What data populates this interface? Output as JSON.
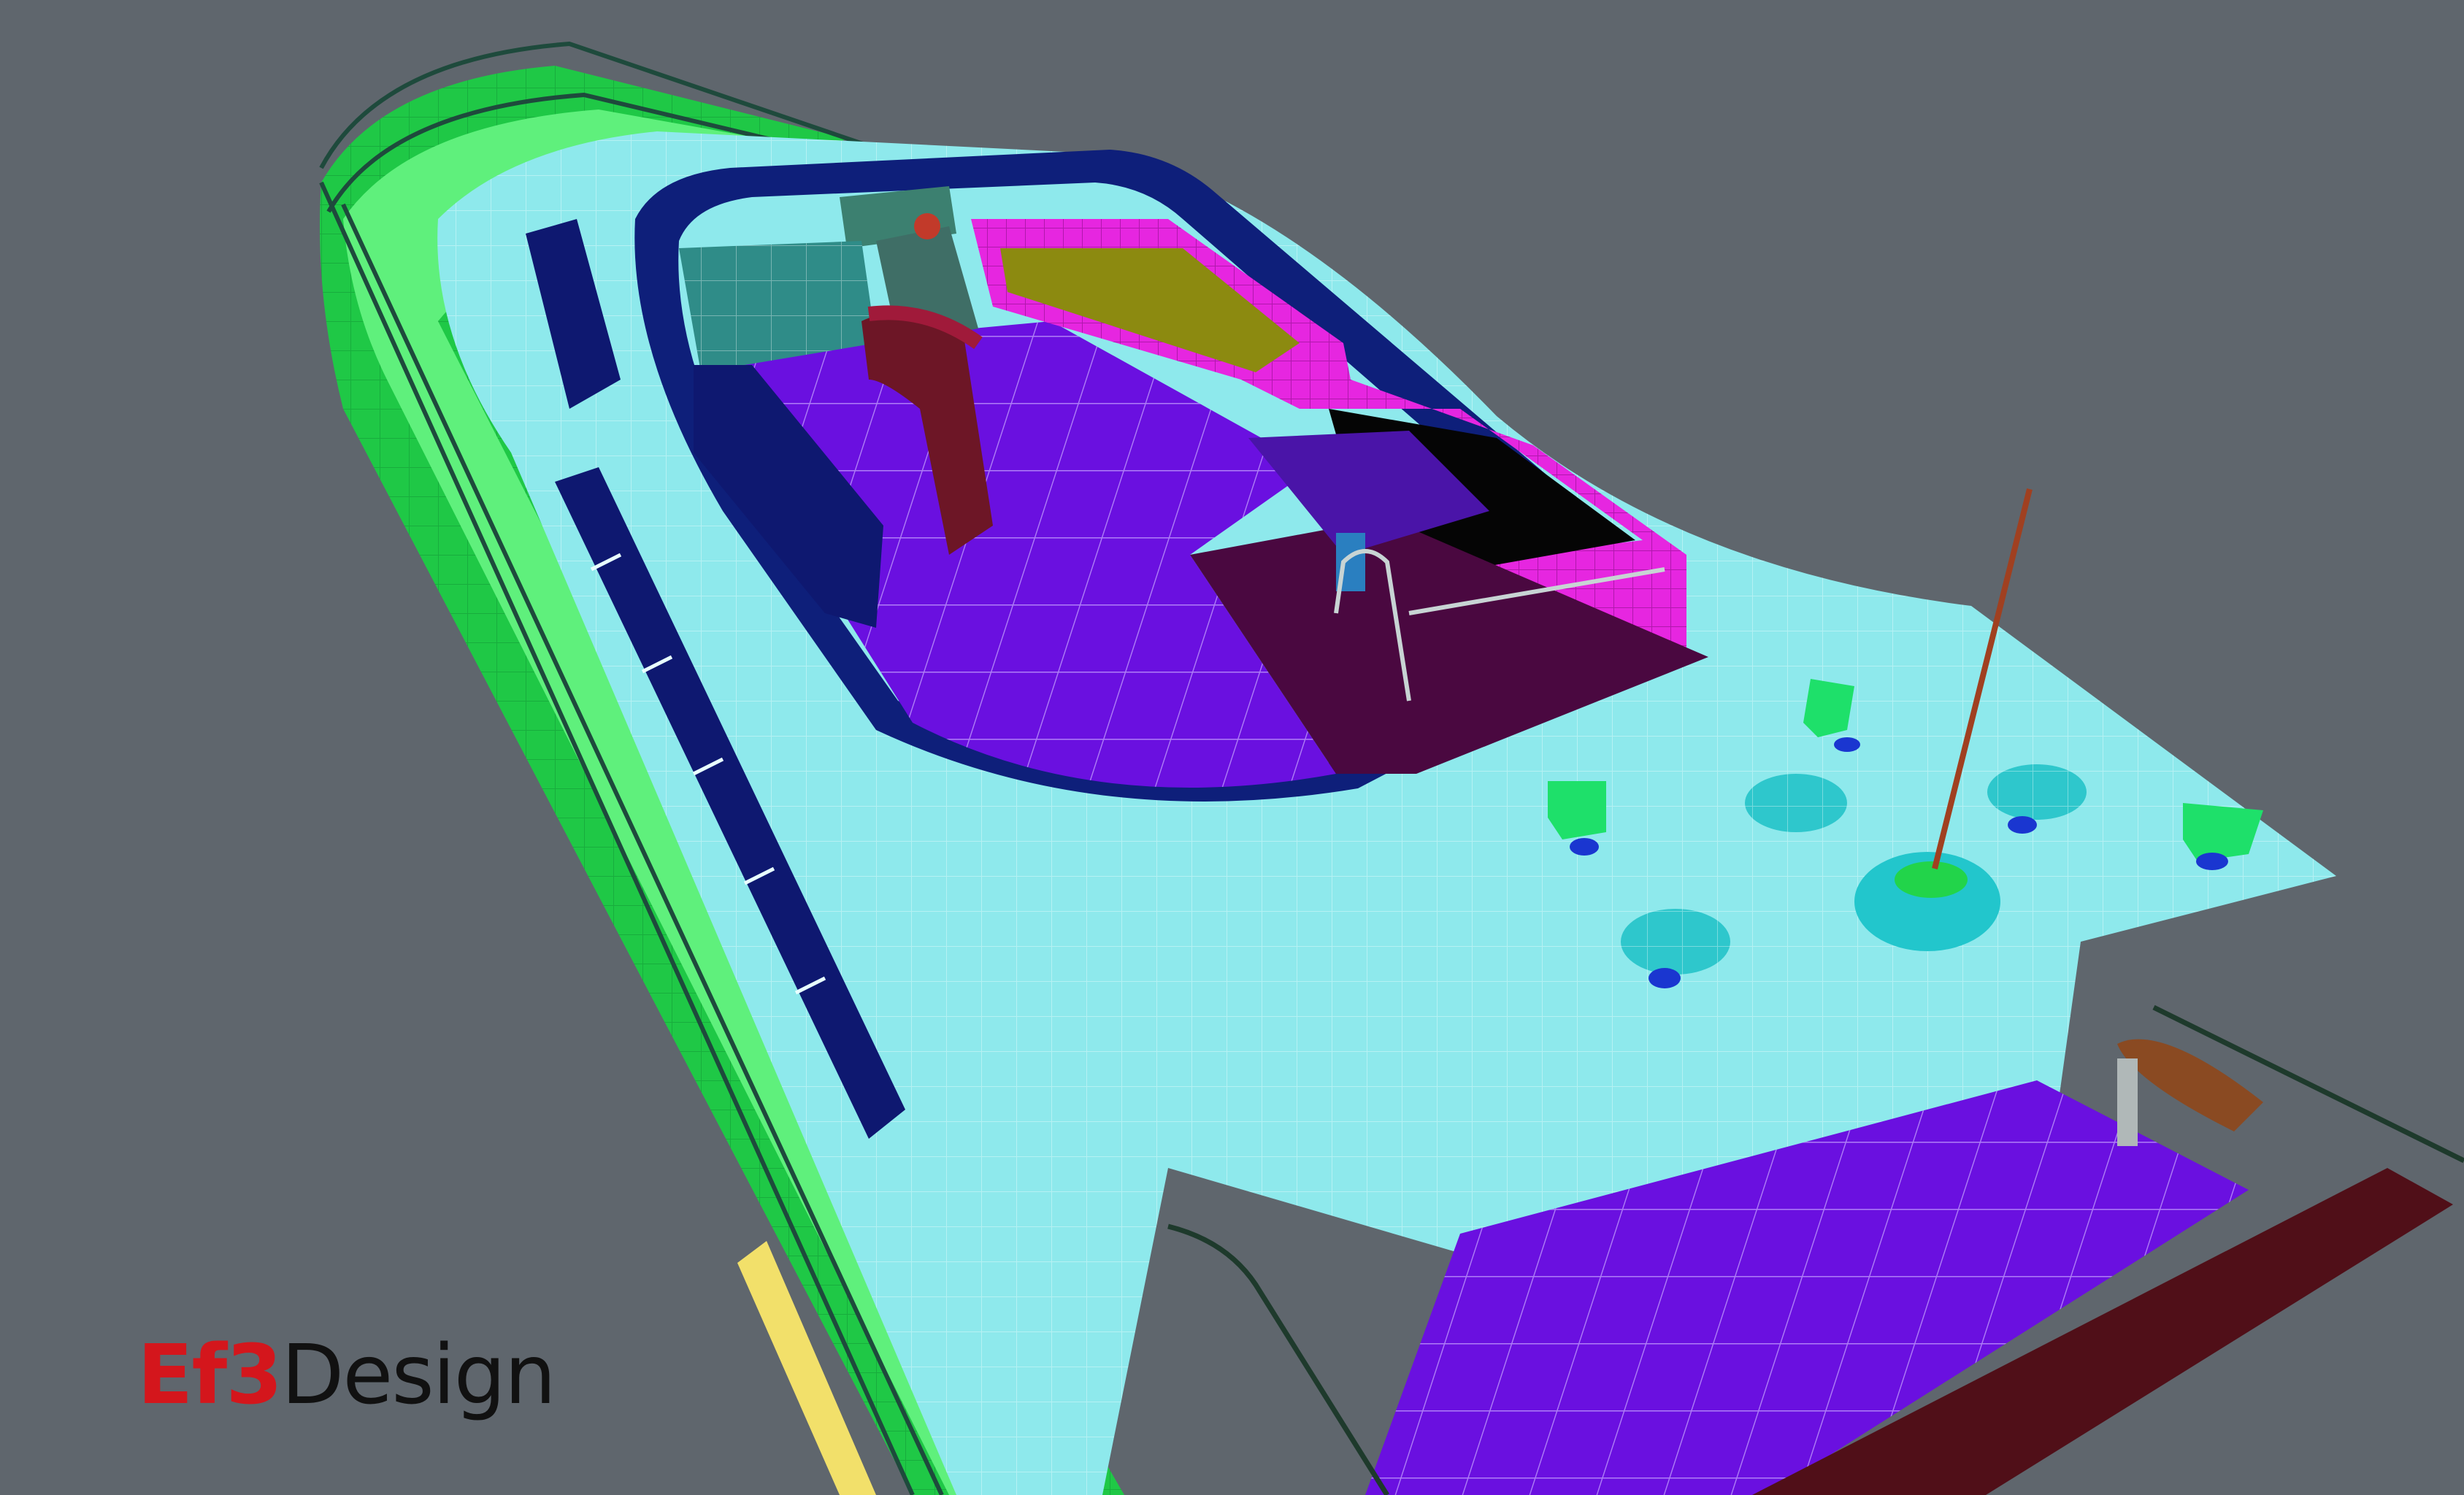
{
  "logo": {
    "brand": "Ef3",
    "word": "Design"
  },
  "colors": {
    "background": "#5f666d",
    "hull_green": "#22d44a",
    "hull_green_light": "#5ff07c",
    "deck_cyan": "#8ee9ec",
    "floor_purple": "#6a10e0",
    "sofa_magenta": "#e626e0",
    "bench_navy": "#0e1870",
    "burgundy": "#6d1626",
    "seat_olive": "#8c8a10",
    "wood_brown": "#8a4a22",
    "rail_dark": "#1e3a2c",
    "brand_red": "#d4161c"
  }
}
